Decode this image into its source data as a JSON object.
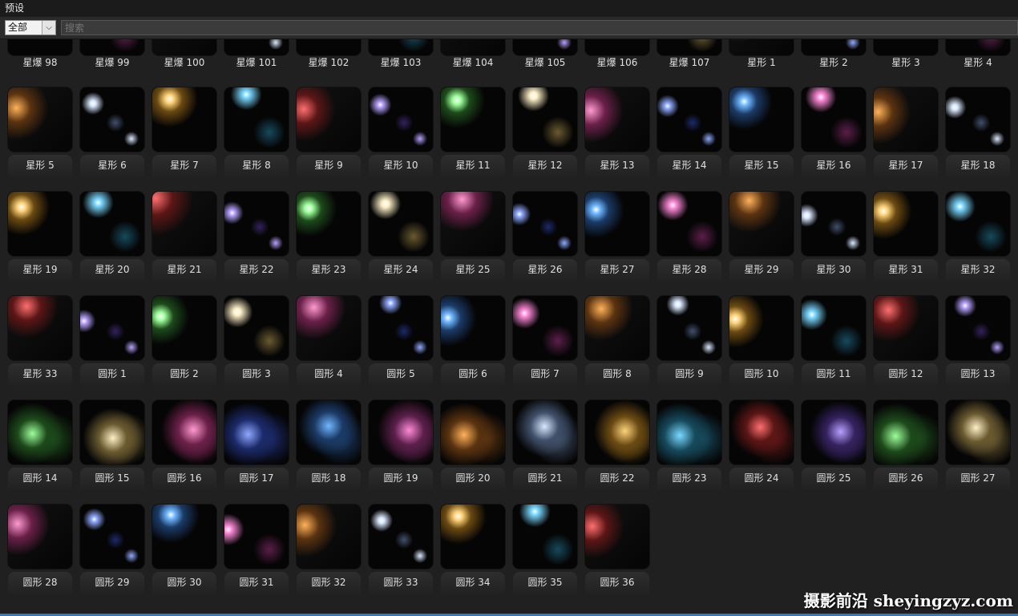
{
  "window": {
    "title": "预设"
  },
  "toolbar": {
    "filter_value": "全部",
    "search_placeholder": "搜索"
  },
  "presets": [
    "星爆 98",
    "星爆 99",
    "星爆 100",
    "星爆 101",
    "星爆 102",
    "星爆 103",
    "星爆 104",
    "星爆 105",
    "星爆 106",
    "星爆 107",
    "星形 1",
    "星形 2",
    "星形 3",
    "星形 4",
    "星形 5",
    "星形 6",
    "星形 7",
    "星形 8",
    "星形 9",
    "星形 10",
    "星形 11",
    "星形 12",
    "星形 13",
    "星形 14",
    "星形 15",
    "星形 16",
    "星形 17",
    "星形 18",
    "星形 19",
    "星形 20",
    "星形 21",
    "星形 22",
    "星形 23",
    "星形 24",
    "星形 25",
    "星形 26",
    "星形 27",
    "星形 28",
    "星形 29",
    "星形 30",
    "星形 31",
    "星形 32",
    "星形 33",
    "圆形 1",
    "圆形 2",
    "圆形 3",
    "圆形 4",
    "圆形 5",
    "圆形 6",
    "圆形 7",
    "圆形 8",
    "圆形 9",
    "圆形 10",
    "圆形 11",
    "圆形 12",
    "圆形 13",
    "圆形 14",
    "圆形 15",
    "圆形 16",
    "圆形 17",
    "圆形 18",
    "圆形 19",
    "圆形 20",
    "圆形 21",
    "圆形 22",
    "圆形 23",
    "圆形 24",
    "圆形 25",
    "圆形 26",
    "圆形 27",
    "圆形 28",
    "圆形 29",
    "圆形 30",
    "圆形 31",
    "圆形 32",
    "圆形 33",
    "圆形 34",
    "圆形 35",
    "圆形 36"
  ],
  "watermark": "摄影前沿 sheyingzyz.com",
  "colors": {
    "background": "#202020",
    "toolbar": "#2a2a2a",
    "thumb_bg": "#050505",
    "accent_edge": "#3a78b5"
  },
  "icons": {
    "filter_dropdown": "chevron-down-icon"
  }
}
